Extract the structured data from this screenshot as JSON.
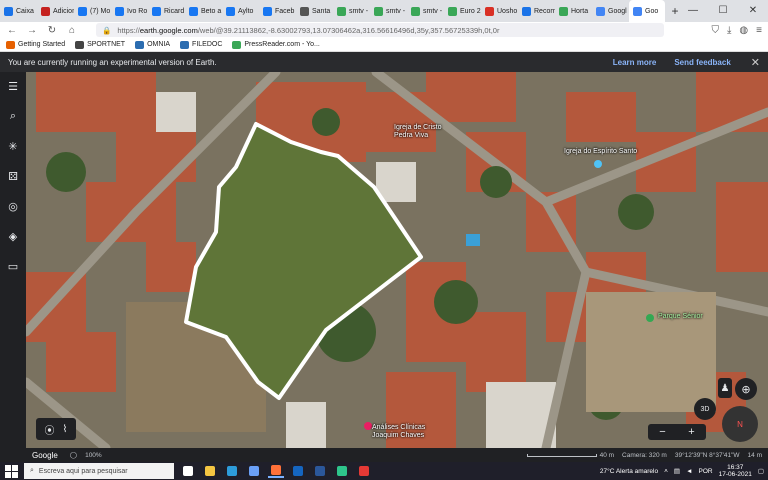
{
  "browser": {
    "tabs": [
      {
        "label": "Caixa",
        "color": "#1a73e8"
      },
      {
        "label": "Adicionar",
        "color": "#c5221f"
      },
      {
        "label": "(7) Mo",
        "color": "#1877f2"
      },
      {
        "label": "Ivo Ro",
        "color": "#1877f2"
      },
      {
        "label": "Ricard",
        "color": "#1877f2"
      },
      {
        "label": "Beto a",
        "color": "#1877f2"
      },
      {
        "label": "Aylto",
        "color": "#1877f2"
      },
      {
        "label": "Faceb",
        "color": "#1877f2"
      },
      {
        "label": "Santa",
        "color": "#555555"
      },
      {
        "label": "smtv -",
        "color": "#3aa757"
      },
      {
        "label": "smtv -",
        "color": "#3aa757"
      },
      {
        "label": "smtv -",
        "color": "#3aa757"
      },
      {
        "label": "Euro 2",
        "color": "#3aa757"
      },
      {
        "label": "Uosho",
        "color": "#d93025"
      },
      {
        "label": "Recom",
        "color": "#1a73e8"
      },
      {
        "label": "Horta",
        "color": "#3aa757"
      },
      {
        "label": "Googl",
        "color": "#4285f4"
      },
      {
        "label": "Goo",
        "color": "#4285f4",
        "active": true
      }
    ],
    "new_tab": "+",
    "window_controls": {
      "min": "—",
      "max": "☐",
      "close": "✕"
    },
    "nav": {
      "back": "←",
      "forward": "→",
      "reload": "↻",
      "home": "⌂"
    },
    "url_prefix": "https://",
    "url_domain": "earth.google.com",
    "url_rest": "/web/@39.21113862,-8.63002793,13.07306462a,316.56616496d,35y,357.56725339h,0t,0r",
    "bookmarks": [
      {
        "label": "Getting Started",
        "color": "#e66000"
      },
      {
        "label": "SPORTNET",
        "color": "#444444"
      },
      {
        "label": "OMNIA",
        "color": "#2b6cb0"
      },
      {
        "label": "FILEDOC",
        "color": "#2b6cb0"
      },
      {
        "label": "PressReader.com - Yo...",
        "color": "#3aa757"
      }
    ]
  },
  "banner": {
    "text": "You are currently running an experimental version of Earth.",
    "learn_more": "Learn more",
    "send_feedback": "Send feedback",
    "close": "✕"
  },
  "sidebar": {
    "menu": "☰",
    "search": "⌕",
    "voyager": "✳",
    "feeling_lucky": "⚄",
    "projects": "◎",
    "map_style": "◈",
    "measure": "▭"
  },
  "map": {
    "labels": {
      "church1_line1": "Igreja de Cristo",
      "church1_line2": "Pedra Viva",
      "church2": "Igreja do Espírito Santo",
      "park": "Parque Sénior",
      "clinic_line1": "Análises Clínicas",
      "clinic_line2": "Joaquim Chaves"
    },
    "controls": {
      "btn_3d": "3D",
      "zoom_out": "−",
      "zoom_in": "+",
      "pegman": "♟",
      "compass_n": "N",
      "locate": "⊕"
    },
    "bottom_left": {
      "location": "⦿",
      "path": "⌇"
    }
  },
  "status": {
    "google": "Google",
    "globe_pct": "100%",
    "scale": "40 m",
    "camera": "Camera: 320 m",
    "coords": "39°12'39\"N 8°37'41\"W",
    "alt": "14 m"
  },
  "taskbar": {
    "search_placeholder": "Escreva aqui para pesquisar",
    "weather": "27°C  Alerta amarelo",
    "lang": "POR",
    "time": "16:37",
    "date": "17-06-2021",
    "apps": [
      {
        "name": "task-view",
        "color": "#ffffff"
      },
      {
        "name": "file-explorer",
        "color": "#f4c542"
      },
      {
        "name": "edge",
        "color": "#2d9cdb"
      },
      {
        "name": "store",
        "color": "#6aa0f7"
      },
      {
        "name": "firefox",
        "color": "#ff7139"
      },
      {
        "name": "outlook",
        "color": "#1565c0"
      },
      {
        "name": "word",
        "color": "#2b579a"
      },
      {
        "name": "edge-dev",
        "color": "#2ec58c"
      },
      {
        "name": "acrobat",
        "color": "#e53935"
      }
    ]
  }
}
